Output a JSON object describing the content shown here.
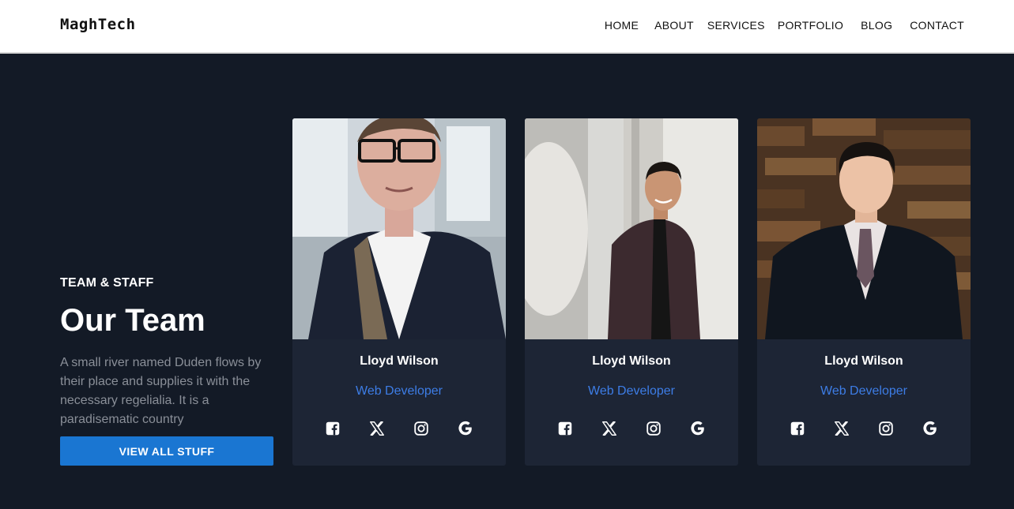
{
  "brand": "MaghTech",
  "nav": [
    "HOME",
    "ABOUT",
    "SERVICES",
    "PORTFOLIO",
    "BLOG",
    "CONTACT"
  ],
  "intro": {
    "eyebrow": "TEAM & STAFF",
    "title": "Our Team",
    "text": "A small river named Duden flows by their place and supplies it with the necessary regelialia. It is a paradisematic country",
    "button": "VIEW ALL STUFF"
  },
  "team": [
    {
      "name": "Lloyd Wilson",
      "role": "Web Developer"
    },
    {
      "name": "Lloyd Wilson",
      "role": "Web Developer"
    },
    {
      "name": "Lloyd Wilson",
      "role": "Web Developer"
    }
  ],
  "social_icons": [
    "facebook-icon",
    "x-icon",
    "instagram-icon",
    "google-icon"
  ],
  "colors": {
    "accent": "#1a76d2",
    "role": "#3d7de6",
    "background": "#131a26",
    "card": "#1d2535"
  }
}
